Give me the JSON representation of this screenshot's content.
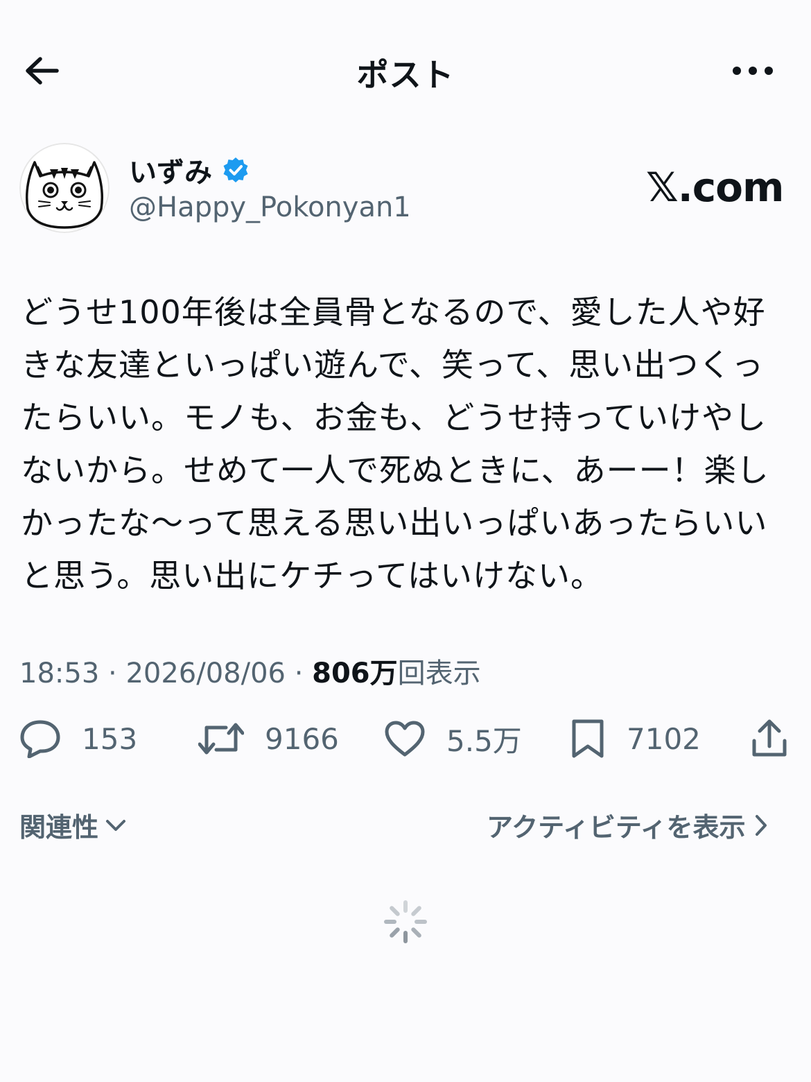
{
  "header": {
    "title": "ポスト",
    "back_icon": "arrow-left-icon",
    "more_icon": "more-horizontal-icon"
  },
  "author": {
    "display_name": "いずみ",
    "verified_icon": "verified-badge-icon",
    "verified_color": "#1d9bf0",
    "handle": "@Happy_Pokonyan1",
    "avatar_icon": "cat-face-avatar"
  },
  "source": {
    "logo_text": "𝕏.com"
  },
  "post": {
    "text": "どうせ100年後は全員骨となるので、愛した人や好\nきな友達といっぱい遊んで、笑って、思い出つくっ\nたらいい。モノも、お金も、どうせ持っていけやし\nないから。せめて一人で死ぬときに、あーー！楽し\nかったな〜って思える思い出いっぱいあったらいい\nと思う。思い出にケチってはいけない。"
  },
  "meta": {
    "time": "18:53",
    "separator": " · ",
    "date": "2026/08/06",
    "views_count": "806万",
    "views_label": "回表示"
  },
  "actions": {
    "reply": {
      "icon": "reply-icon",
      "count": "153"
    },
    "repost": {
      "icon": "repost-icon",
      "count": "9166"
    },
    "like": {
      "icon": "heart-icon",
      "count": "5.5万"
    },
    "bookmark": {
      "icon": "bookmark-icon",
      "count": "7102"
    },
    "share": {
      "icon": "share-icon"
    }
  },
  "filters": {
    "relevance_label": "関連性",
    "activity_label": "アクティビティを表示"
  },
  "colors": {
    "text": "#0f1419",
    "secondary": "#536471",
    "background": "#fbfbfd",
    "accent": "#1d9bf0"
  }
}
